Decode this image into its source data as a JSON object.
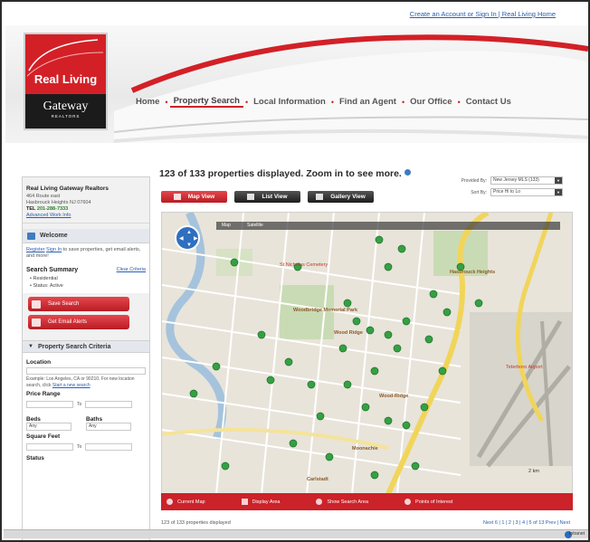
{
  "top_link": "Create an Account or Sign In | Real Living Home",
  "logo": {
    "brand": "Real Living",
    "office": "Gateway",
    "tagline": "REALTORS",
    "colors": {
      "red": "#d32027",
      "dark": "#1b1b1b"
    }
  },
  "nav": {
    "items": [
      {
        "label": "Home"
      },
      {
        "label": "Property Search",
        "active": true
      },
      {
        "label": "Local Information"
      },
      {
        "label": "Find an Agent"
      },
      {
        "label": "Our Office"
      },
      {
        "label": "Contact Us"
      }
    ],
    "separator": "•"
  },
  "sidebar": {
    "office": {
      "name": "Real Living Gateway Realtors",
      "address1": "464 Route east",
      "address2": "Hasbrouck Heights NJ 07604",
      "phone_label": "TEL",
      "phone": "201-288-7333",
      "link": "Advanced Work Info"
    },
    "welcome": {
      "title": "Welcome",
      "register": "Register",
      "sign_in": "Sign In",
      "text": "to save properties, get email alerts, and more!"
    },
    "search_summary": {
      "title": "Search Summary",
      "clear": "Clear Criteria",
      "items": [
        "Residential",
        "Status: Active"
      ]
    },
    "buttons": {
      "save_search": "Save Search",
      "email_alerts": "Get Email Alerts"
    },
    "criteria": {
      "title": "Property Search Criteria",
      "location_label": "Location",
      "location_hint": "Example: Los Angeles, CA or 90210. For new location search, click",
      "location_link": "Start a new search",
      "price_label": "Price Range",
      "to": "To",
      "beds_label": "Beds",
      "baths_label": "Baths",
      "beds_value": "Any",
      "baths_value": "Any",
      "sqft_label": "Square Feet",
      "status_label": "Status"
    }
  },
  "main": {
    "results_text": "123 of 133 properties displayed. Zoom in to see more.",
    "provided_by_label": "Provided By:",
    "provided_by_value": "New Jersey MLS (133)",
    "sort_by_label": "Sort By:",
    "sort_by_value": "Price Hi to Lo",
    "views": {
      "map": "Map View",
      "list": "List View",
      "gallery": "Gallery View"
    },
    "map": {
      "top_bar": [
        "Map",
        "Satellite"
      ],
      "labels": {
        "hasbrouck": "Hasbrouck Heights",
        "cemetery": "St Nicholas Cemetery",
        "woodridge_park": "Woodbridge Memorial Park",
        "woodridge": "Wood-Ridge",
        "moonachie": "Moonachie",
        "carlstadt": "Carlstadt",
        "teterboro": "Teterboro Airport",
        "wood_ridge_2": "Wood Ridge"
      },
      "scale": "2 km",
      "colors": {
        "land": "#e8e4da",
        "water": "#a5c3dc",
        "park": "#c9dbb4",
        "highway": "#f1d55a",
        "pin": "#35a043"
      }
    },
    "toolbar": {
      "current_map": "Current Map",
      "display_area": "Display Area",
      "show_search_area": "Show Search Area",
      "points_of_interest": "Points of Interest"
    },
    "footer_count": "123 of 133 properties displayed",
    "pager": "Next 6 | 1 | 2 | 3 | 4 | 5 of 13   Prev | Next"
  },
  "status_bar": {
    "text": "Intranet"
  }
}
